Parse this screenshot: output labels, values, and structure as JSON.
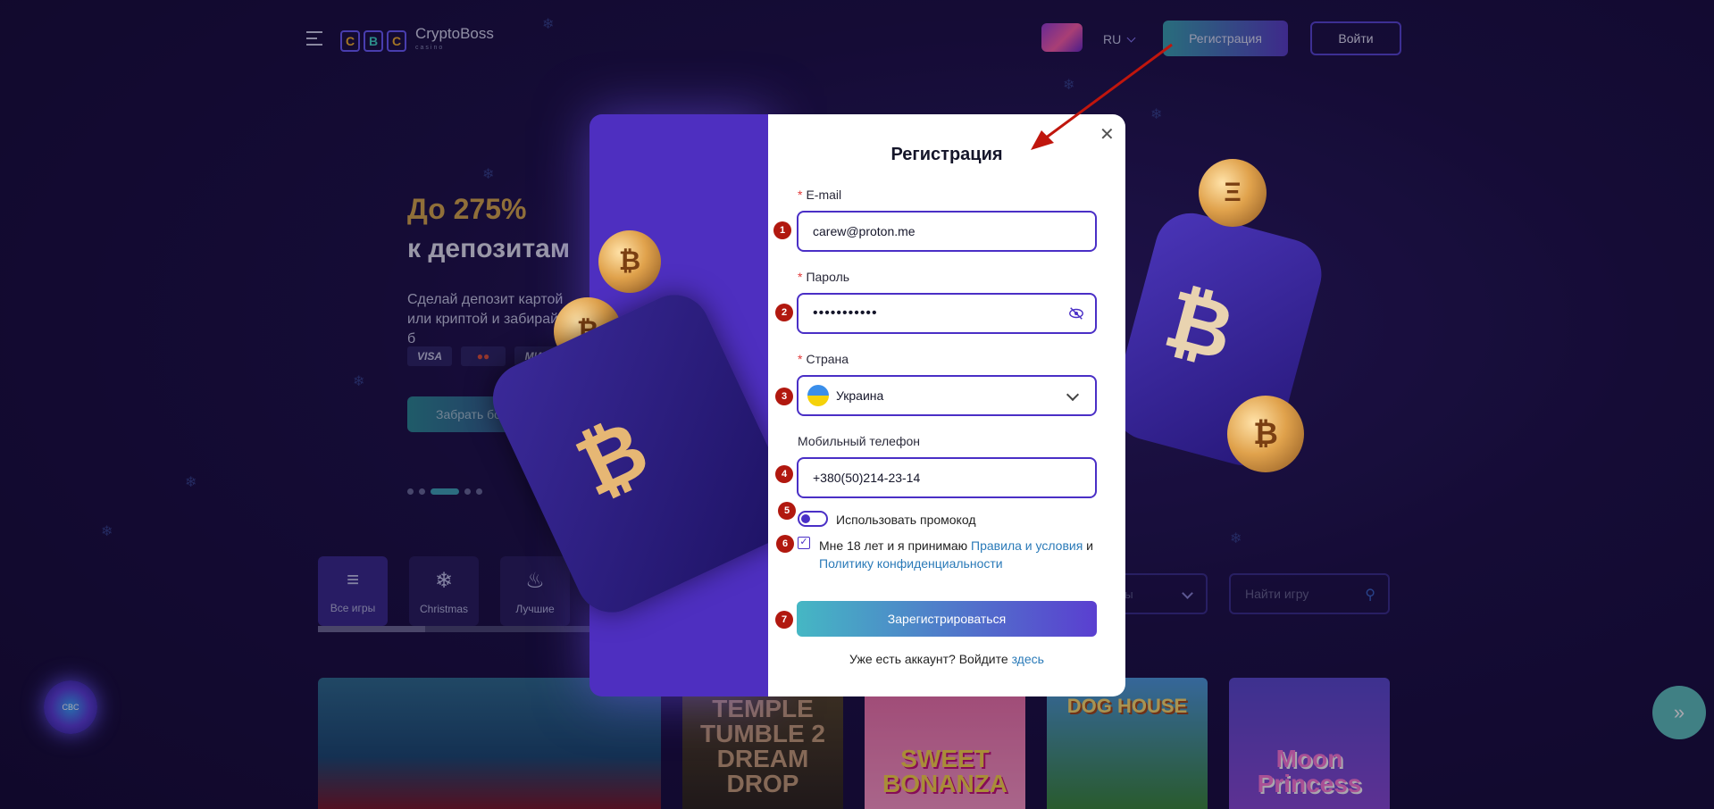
{
  "header": {
    "logo_text": "CryptoBoss",
    "logo_sub": "casino",
    "logo_letters": [
      "C",
      "B",
      "C"
    ],
    "lang": "RU",
    "register_label": "Регистрация",
    "login_label": "Войти"
  },
  "hero": {
    "title1": "До 275%",
    "title2": "к депозитам",
    "desc": "Сделай депозит картой или криптой и забирай б",
    "payments": [
      "VISA",
      "●●",
      "МИР"
    ],
    "button": "Забрать бонус"
  },
  "categories": [
    {
      "label": "Все игры",
      "icon": "list-icon"
    },
    {
      "label": "Christmas",
      "icon": "snowflake-icon"
    },
    {
      "label": "Лучшие",
      "icon": "fire-icon"
    }
  ],
  "filters": {
    "provider_placeholder": "ры",
    "search_placeholder": "Найти игру"
  },
  "games": [
    "",
    "TEMPLE TUMBLE 2 DREAM DROP",
    "SWEET BONANZA",
    "DOG HOUSE",
    "Moon Princess"
  ],
  "modal": {
    "title": "Регистрация",
    "email_label": "E-mail",
    "email_value": "carew@proton.me",
    "password_label": "Пароль",
    "password_value": "•••••••••••",
    "country_label": "Страна",
    "country_value": "Украина",
    "phone_label": "Мобильный телефон",
    "phone_value": "+380(50)214-23-14",
    "promo_label": "Использовать промокод",
    "terms_prefix": "Мне 18 лет и я принимаю ",
    "terms_link1": "Правила и условия",
    "terms_and": " и ",
    "terms_link2": "Политику конфиденциальности",
    "submit_label": "Зарегистрироваться",
    "already_text": "Уже есть аккаунт? Войдите ",
    "already_link": "здесь",
    "required_mark": "*"
  },
  "markers": [
    "1",
    "2",
    "3",
    "4",
    "5",
    "6",
    "7"
  ],
  "colors": {
    "accent": "#4a2fc6",
    "marker": "#b1180f",
    "link": "#2a7ab8"
  }
}
